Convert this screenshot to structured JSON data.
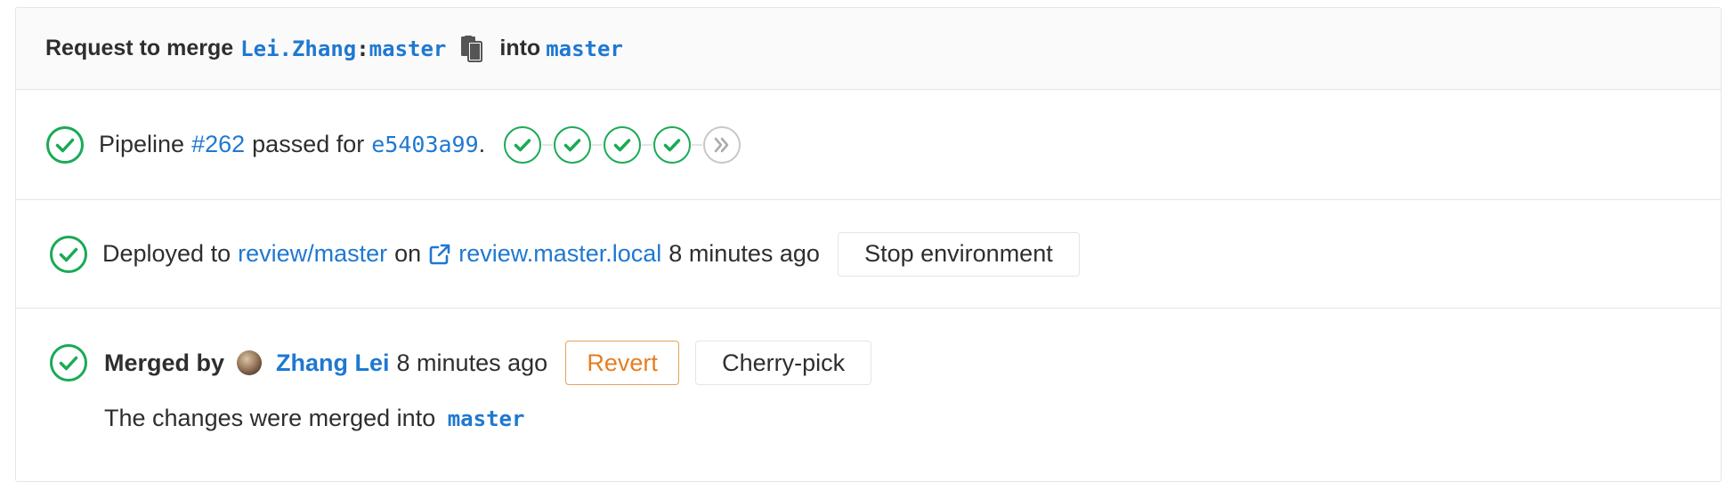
{
  "header": {
    "prefix": "Request to merge",
    "source_user": "Lei.Zhang",
    "separator": ":",
    "source_branch": "master",
    "copy_icon": "clipboard-icon",
    "into_text": "into",
    "target_branch": "master"
  },
  "pipeline": {
    "status_icon": "success-check-icon",
    "label": "Pipeline",
    "id": "#262",
    "passed_for": "passed for",
    "commit": "e5403a99",
    "period": ".",
    "stages": [
      {
        "status": "success",
        "icon": "success-check-icon"
      },
      {
        "status": "success",
        "icon": "success-check-icon"
      },
      {
        "status": "success",
        "icon": "success-check-icon"
      },
      {
        "status": "success",
        "icon": "success-check-icon"
      },
      {
        "status": "skipped",
        "icon": "skipped-double-chevron-icon"
      }
    ]
  },
  "deploy": {
    "status_icon": "success-check-icon",
    "prefix": "Deployed to",
    "environment": "review/master",
    "on_text": "on",
    "external_icon": "external-link-icon",
    "url": "review.master.local",
    "time": "8 minutes ago",
    "stop_button": "Stop environment"
  },
  "merged": {
    "status_icon": "success-check-icon",
    "label": "Merged by",
    "user": "Zhang Lei",
    "time": "8 minutes ago",
    "revert_button": "Revert",
    "cherry_pick_button": "Cherry-pick",
    "note_prefix": "The changes were merged into",
    "note_branch": "master"
  },
  "colors": {
    "success": "#1aaa55",
    "link": "#1f78d1",
    "revert": "#e67e22",
    "border": "#e5e5e5",
    "header_bg": "#fafafa"
  }
}
